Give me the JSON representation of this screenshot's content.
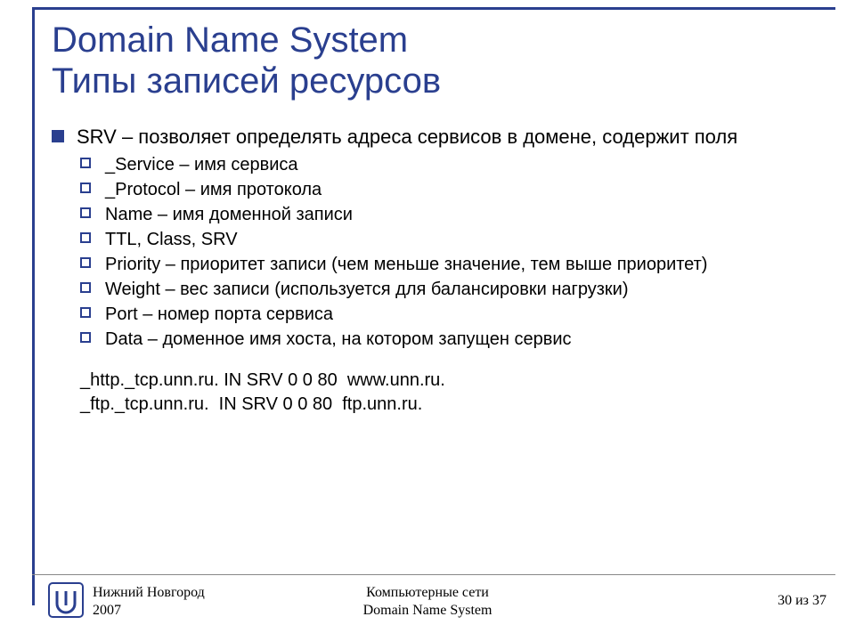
{
  "title_line1": "Domain Name System",
  "title_line2": "Типы записей ресурсов",
  "main_item": "SRV – позволяет определять адреса сервисов в домене, содержит поля",
  "sub_items": [
    "_Service – имя сервиса",
    "_Protocol – имя протокола",
    "Name – имя доменной записи",
    "TTL, Class, SRV",
    "Priority – приоритет записи (чем меньше значение, тем выше приоритет)",
    "Weight – вес записи (используется для балансировки нагрузки)",
    "Port – номер порта сервиса",
    "Data – доменное имя хоста, на котором запущен сервис"
  ],
  "example1": "_http._tcp.unn.ru. IN SRV 0 0 80  www.unn.ru.",
  "example2": "_ftp._tcp.unn.ru.  IN SRV 0 0 80  ftp.unn.ru.",
  "footer": {
    "left_line1": "Нижний Новгород",
    "left_line2": "2007",
    "center_line1": "Компьютерные сети",
    "center_line2": "Domain Name System",
    "page": "30 из 37"
  }
}
